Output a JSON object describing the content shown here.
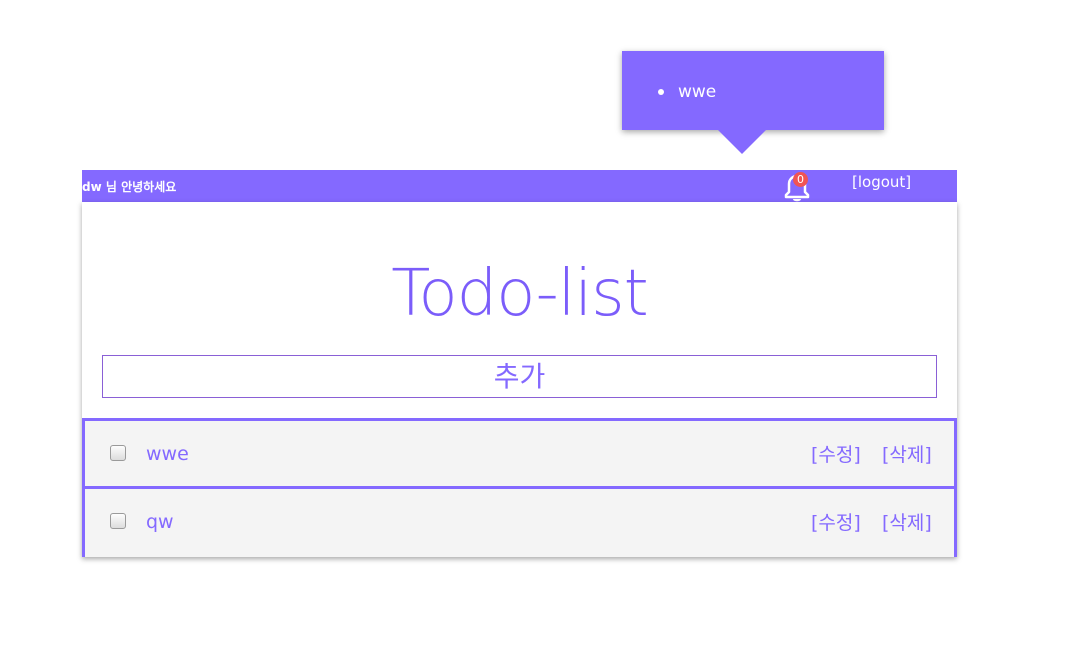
{
  "notification_popup": {
    "items": [
      "wwe"
    ]
  },
  "header": {
    "greeting": "dw 님 안녕하세요",
    "notification_count": "0",
    "logout_label": "[logout]"
  },
  "main": {
    "title": "Todo-list",
    "add_placeholder": "추가"
  },
  "todos": [
    {
      "text": "wwe",
      "checked": false,
      "edit_label": "[수정]",
      "delete_label": "[삭제]"
    },
    {
      "text": "qw",
      "checked": false,
      "edit_label": "[수정]",
      "delete_label": "[삭제]"
    }
  ],
  "colors": {
    "accent": "#8469ff",
    "badge": "#f05454",
    "row_background": "#f4f4f4"
  }
}
